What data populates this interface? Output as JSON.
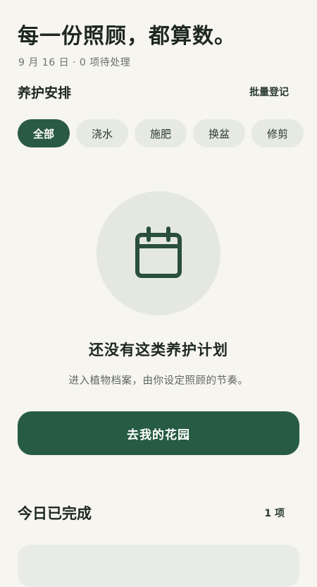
{
  "header": {
    "title": "每一份照顾，都算数。",
    "subtitle": "9 月 16 日 · 0 项待处理"
  },
  "schedule": {
    "title": "养护安排",
    "bulk_action": "批量登记",
    "filters": [
      {
        "label": "全部",
        "active": true
      },
      {
        "label": "浇水",
        "active": false
      },
      {
        "label": "施肥",
        "active": false
      },
      {
        "label": "换盆",
        "active": false
      },
      {
        "label": "修剪",
        "active": false
      }
    ]
  },
  "empty_state": {
    "icon": "calendar-icon",
    "title": "还没有这类养护计划",
    "description": "进入植物档案，由你设定照顾的节奏。",
    "button_label": "去我的花园"
  },
  "completed": {
    "title": "今日已完成",
    "count_label": "1 项"
  },
  "colors": {
    "background": "#F6F5F0",
    "accent": "#275B44",
    "chip_inactive": "#E6EAE3",
    "icon_circle": "#E4E8E0"
  }
}
